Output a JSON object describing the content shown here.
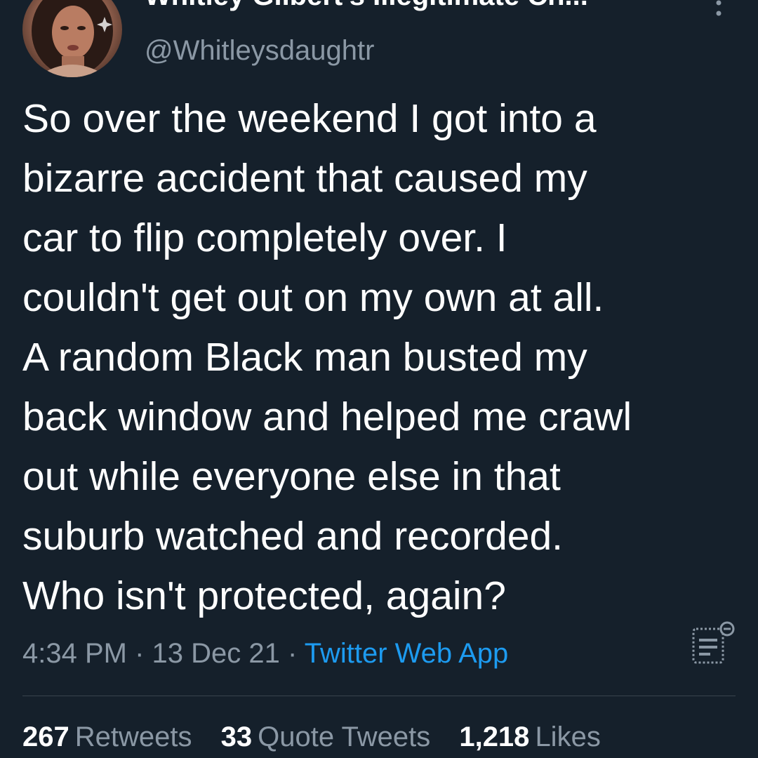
{
  "user": {
    "display_name": "Whitley Gilbert's Illegitimate Ch...",
    "handle": "@Whitleysdaughtr",
    "avatar_icon": "avatar-image"
  },
  "tweet": {
    "lines": [
      "So over the weekend I got into a",
      "bizarre accident that caused my",
      "car to flip completely over. I",
      "couldn't get out on my own at all.",
      "A random Black man busted my",
      "back window and helped me crawl",
      "out while everyone else in that",
      "suburb watched and recorded.",
      "Who isn't protected, again?"
    ],
    "time": "4:34 PM",
    "sep1": "·",
    "date": "13 Dec 21",
    "sep2": "·",
    "source": "Twitter Web App"
  },
  "stats": {
    "retweets_count": "267",
    "retweets_label": "Retweets",
    "quote_count": "33",
    "quote_label": "Quote Tweets",
    "likes_count": "1,218",
    "likes_label": "Likes"
  },
  "colors": {
    "background": "#15202b",
    "text": "#ffffff",
    "secondary": "#8b98a5",
    "link": "#1d9bf0",
    "divider": "#38444d"
  },
  "icons": {
    "more": "more-vertical-icon",
    "analytics": "analytics-icon"
  }
}
